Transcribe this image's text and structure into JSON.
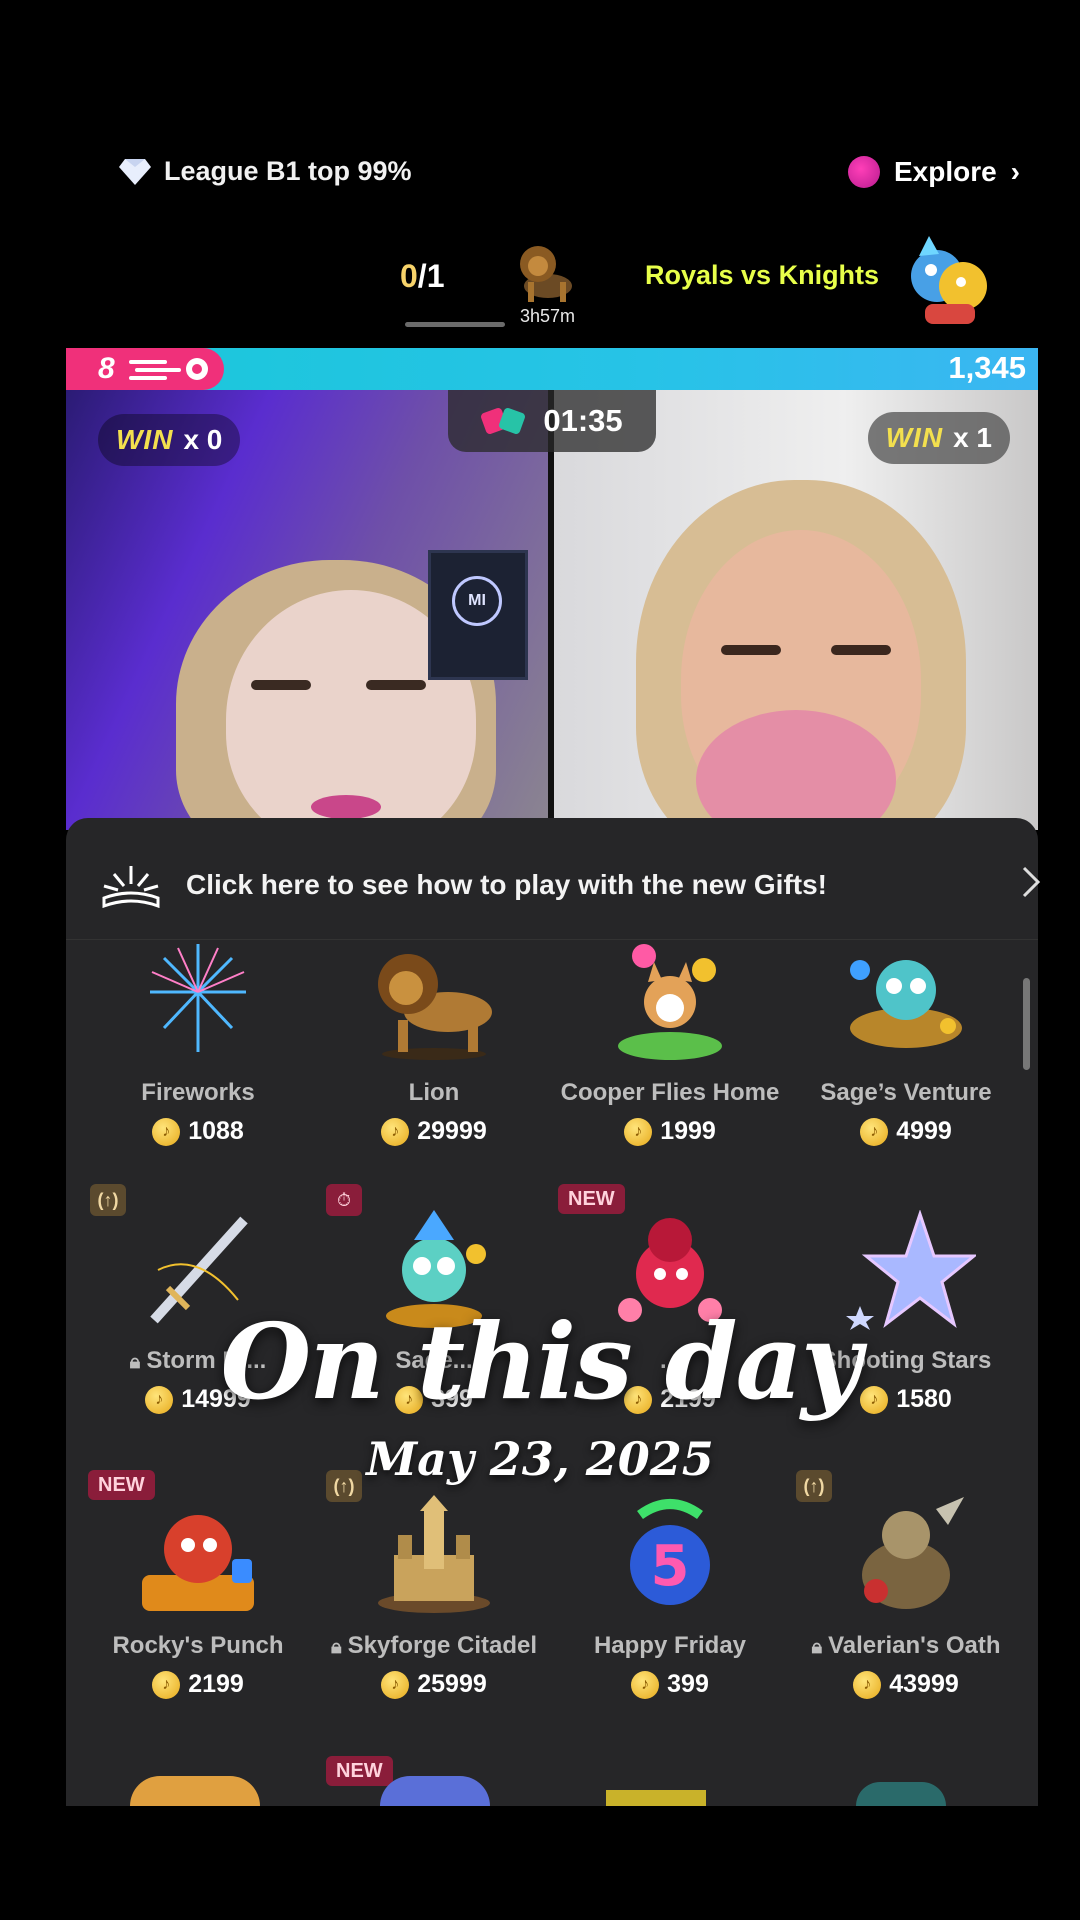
{
  "header": {
    "league_text": "League B1 top 99%",
    "explore_text": "Explore",
    "score_wins": "0",
    "score_total": "/1",
    "event_timer": "3h57m",
    "event_title": "Royals vs Knights"
  },
  "battle": {
    "left_value": "8",
    "right_score": "1,345",
    "countdown": "01:35",
    "left_win_label": "WIN",
    "left_win_count": "x 0",
    "right_win_label": "WIN",
    "right_win_count": "x 1",
    "poster_text": "MI"
  },
  "gift_sheet": {
    "banner_text": "Click here to see how to play with the new Gifts!",
    "rows": [
      [
        {
          "name": "Fireworks",
          "price": "1088",
          "locked": false,
          "tag": ""
        },
        {
          "name": "Lion",
          "price": "29999",
          "locked": false,
          "tag": ""
        },
        {
          "name": "Cooper Flies Home",
          "price": "1999",
          "locked": false,
          "tag": ""
        },
        {
          "name": "Sage’s Venture",
          "price": "4999",
          "locked": false,
          "tag": ""
        }
      ],
      [
        {
          "name": "Storm Bl...",
          "price": "14999",
          "locked": true,
          "tag": "icon"
        },
        {
          "name": "Sage...",
          "price": "399",
          "locked": false,
          "tag": "timer"
        },
        {
          "name": "...",
          "price": "2199",
          "locked": false,
          "tag": "NEW"
        },
        {
          "name": "Shooting Stars",
          "price": "1580",
          "locked": false,
          "tag": ""
        }
      ],
      [
        {
          "name": "Rocky's Punch",
          "price": "2199",
          "locked": false,
          "tag": "NEW"
        },
        {
          "name": "Skyforge Citadel",
          "price": "25999",
          "locked": true,
          "tag": "icon"
        },
        {
          "name": "Happy Friday",
          "price": "399",
          "locked": false,
          "tag": ""
        },
        {
          "name": "Valerian's Oath",
          "price": "43999",
          "locked": true,
          "tag": "icon"
        }
      ]
    ],
    "next_row_tag": "NEW"
  },
  "overlay": {
    "title": "On this day",
    "date": "May 23, 2025"
  },
  "colors": {
    "accent_pink": "#f0307a",
    "accent_cyan": "#27c3e7",
    "win_yellow": "#f3e04e",
    "royals_yellow": "#e8ff4a"
  }
}
